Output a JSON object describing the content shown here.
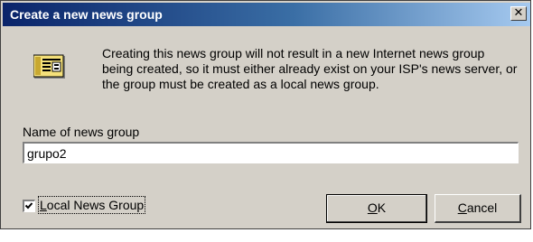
{
  "window": {
    "title": "Create a new news group",
    "close_glyph": "✕"
  },
  "info": {
    "icon": "news-group-icon",
    "text": "Creating this news group will not result in a new Internet news group being created, so it must either already exist on your ISP's news server, or the group must be created as a local news group."
  },
  "name_field": {
    "label": "Name of news group",
    "value": "grupo2"
  },
  "local_group": {
    "checked": true,
    "label_mnemonic": "L",
    "label_rest": "ocal News Group"
  },
  "buttons": {
    "ok_mnemonic": "O",
    "ok_rest": "K",
    "cancel_mnemonic": "C",
    "cancel_rest": "ancel"
  },
  "colors": {
    "dialog_bg": "#d4d0c8",
    "title_start": "#0a246a",
    "title_end": "#a6caf0"
  }
}
